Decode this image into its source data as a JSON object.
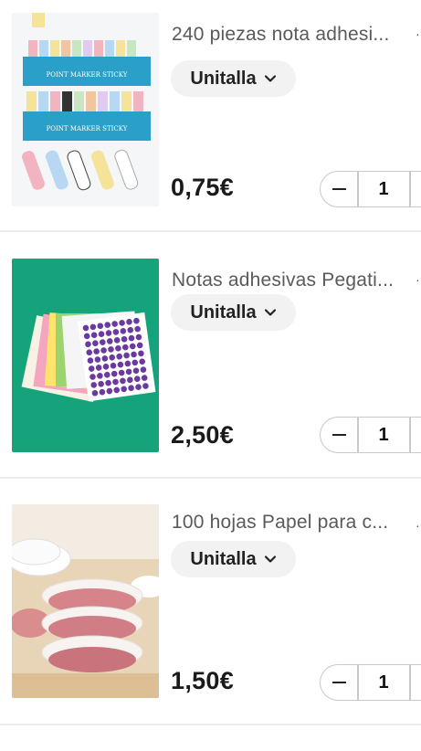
{
  "products": [
    {
      "title": "240 piezas nota adhesi...",
      "size_label": "Unitalla",
      "price": "0,75€",
      "quantity": "1",
      "image_icon": "sticky-notes-image"
    },
    {
      "title": "Notas adhesivas Pegati...",
      "size_label": "Unitalla",
      "price": "2,50€",
      "quantity": "1",
      "image_icon": "dot-stickers-image"
    },
    {
      "title": "100 hojas Papel para c...",
      "size_label": "Unitalla",
      "price": "1,50€",
      "quantity": "1",
      "image_icon": "burger-paper-image"
    }
  ],
  "image_text": {
    "sticky_label": "POINT MARKER STICKY"
  },
  "colors": {
    "sticky_bg": "#2aa0c8",
    "dots_bg": "#14a37a",
    "paper_bg": "#e8d5b8"
  }
}
